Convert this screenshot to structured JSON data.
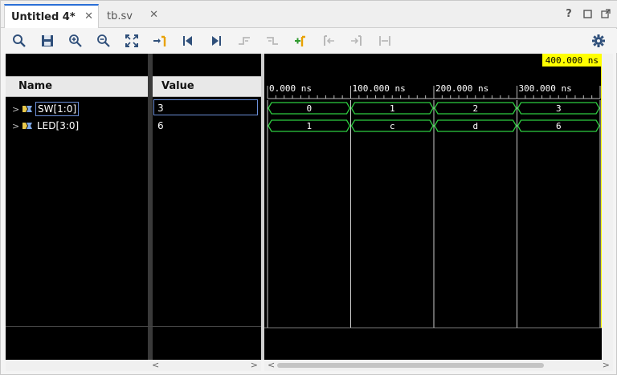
{
  "tabs": [
    {
      "label": "Untitled 4*",
      "active": true
    },
    {
      "label": "tb.sv",
      "active": false
    }
  ],
  "window_controls": [
    "help-icon",
    "restore-icon",
    "float-icon"
  ],
  "toolbar": {
    "icons": [
      "search-icon",
      "save-icon",
      "zoom-in-icon",
      "zoom-out-icon",
      "zoom-fit-icon",
      "go-to-cursor-icon",
      "go-to-start-icon",
      "go-to-end-icon",
      "previous-transition-icon",
      "next-transition-icon",
      "add-marker-icon",
      "previous-marker-icon",
      "next-marker-icon",
      "swap-cursors-icon",
      "gear-icon"
    ]
  },
  "columns": {
    "name": "Name",
    "value": "Value"
  },
  "signals": [
    {
      "name": "SW[1:0]",
      "value": "3",
      "segments": [
        "0",
        "1",
        "2",
        "3"
      ]
    },
    {
      "name": "LED[3:0]",
      "value": "6",
      "segments": [
        "1",
        "c",
        "d",
        "6"
      ]
    }
  ],
  "timeline": {
    "ticks": [
      "0.000 ns",
      "100.000 ns",
      "200.000 ns",
      "300.000 ns"
    ],
    "cursor_label": "400.000 ns",
    "segment_count": 4
  },
  "colors": {
    "wave": "#2ecc40",
    "text": "#ffffff",
    "cursor": "#ffff00",
    "background": "#000000"
  }
}
